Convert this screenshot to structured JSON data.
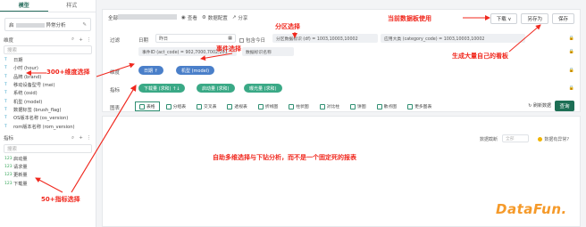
{
  "sidebar": {
    "tabs": [
      "模型",
      "样式"
    ],
    "dataset_name": "启",
    "dataset_suffix": "异常分析",
    "dimension_title": "维度",
    "dimension_search": "搜索",
    "dimensions": [
      {
        "type": "T",
        "label": "日期"
      },
      {
        "type": "T",
        "label": "小时 (hour)"
      },
      {
        "type": "T",
        "label": "品牌 (brand)"
      },
      {
        "type": "T",
        "label": "移动设备型号 (mei)"
      },
      {
        "type": "T",
        "label": "系统 (osid)"
      },
      {
        "type": "T",
        "label": "机型 (model)"
      },
      {
        "type": "T",
        "label": "数据标签 (brush_flag)"
      },
      {
        "type": "T",
        "label": "OS版本名称 (os_version)"
      },
      {
        "type": "T",
        "label": "rom版本名称 (rom_version)"
      }
    ],
    "metric_title": "指标",
    "metric_search": "搜索",
    "metrics": [
      {
        "type": "123",
        "label": "启动量"
      },
      {
        "type": "123",
        "label": "请求量"
      },
      {
        "type": "123",
        "label": "更新量"
      },
      {
        "type": "123",
        "label": "下载量"
      }
    ]
  },
  "toolbar": {
    "title": "全部",
    "items": [
      "查看",
      "数据配置",
      "分享"
    ]
  },
  "buttons": {
    "download": "下载 ∨",
    "save_as": "另存为",
    "save": "保存"
  },
  "filter": {
    "label": "过滤",
    "date_label": "日期",
    "date_value": "昨日",
    "include_today": "包含今日",
    "chips": [
      "分区数据标识 (df) = 1003,10003,10002",
      "应用大类 (category_code) = 1003,10003,10002",
      "事件ID (act_code) = 902,7000,7002,201",
      "数据标识名称"
    ]
  },
  "dimension_row": {
    "label": "维度",
    "pills": [
      "日期 ↑",
      "机型 (model)"
    ]
  },
  "metric_row": {
    "label": "指标",
    "pills": [
      "下载量 (求和) ↑↓",
      "启动量 (求和)",
      "曝光量 (求和)"
    ]
  },
  "chart_types": {
    "label": "图表",
    "items": [
      "表格",
      "分组表",
      "交叉表",
      "透视表",
      "折线图",
      "柱状图",
      "对比柱",
      "饼图",
      "散点图",
      "更多图表"
    ],
    "refresh": "刷新数据",
    "query": "查询"
  },
  "results": {
    "data_label": "数据截断",
    "data_placeholder": "全部",
    "compare_label": "数据有异常?"
  },
  "annotations": {
    "partition": "分区选择",
    "event": "事件选择",
    "current_board": "当前数据板使用",
    "generate": "生成大量自己的看板",
    "dimension": "300+维度选择",
    "metric": "50+指标选择",
    "freeform": "自助多维选择与下钻分析，而不是一个固定死的报表"
  },
  "watermark": "DataFun."
}
